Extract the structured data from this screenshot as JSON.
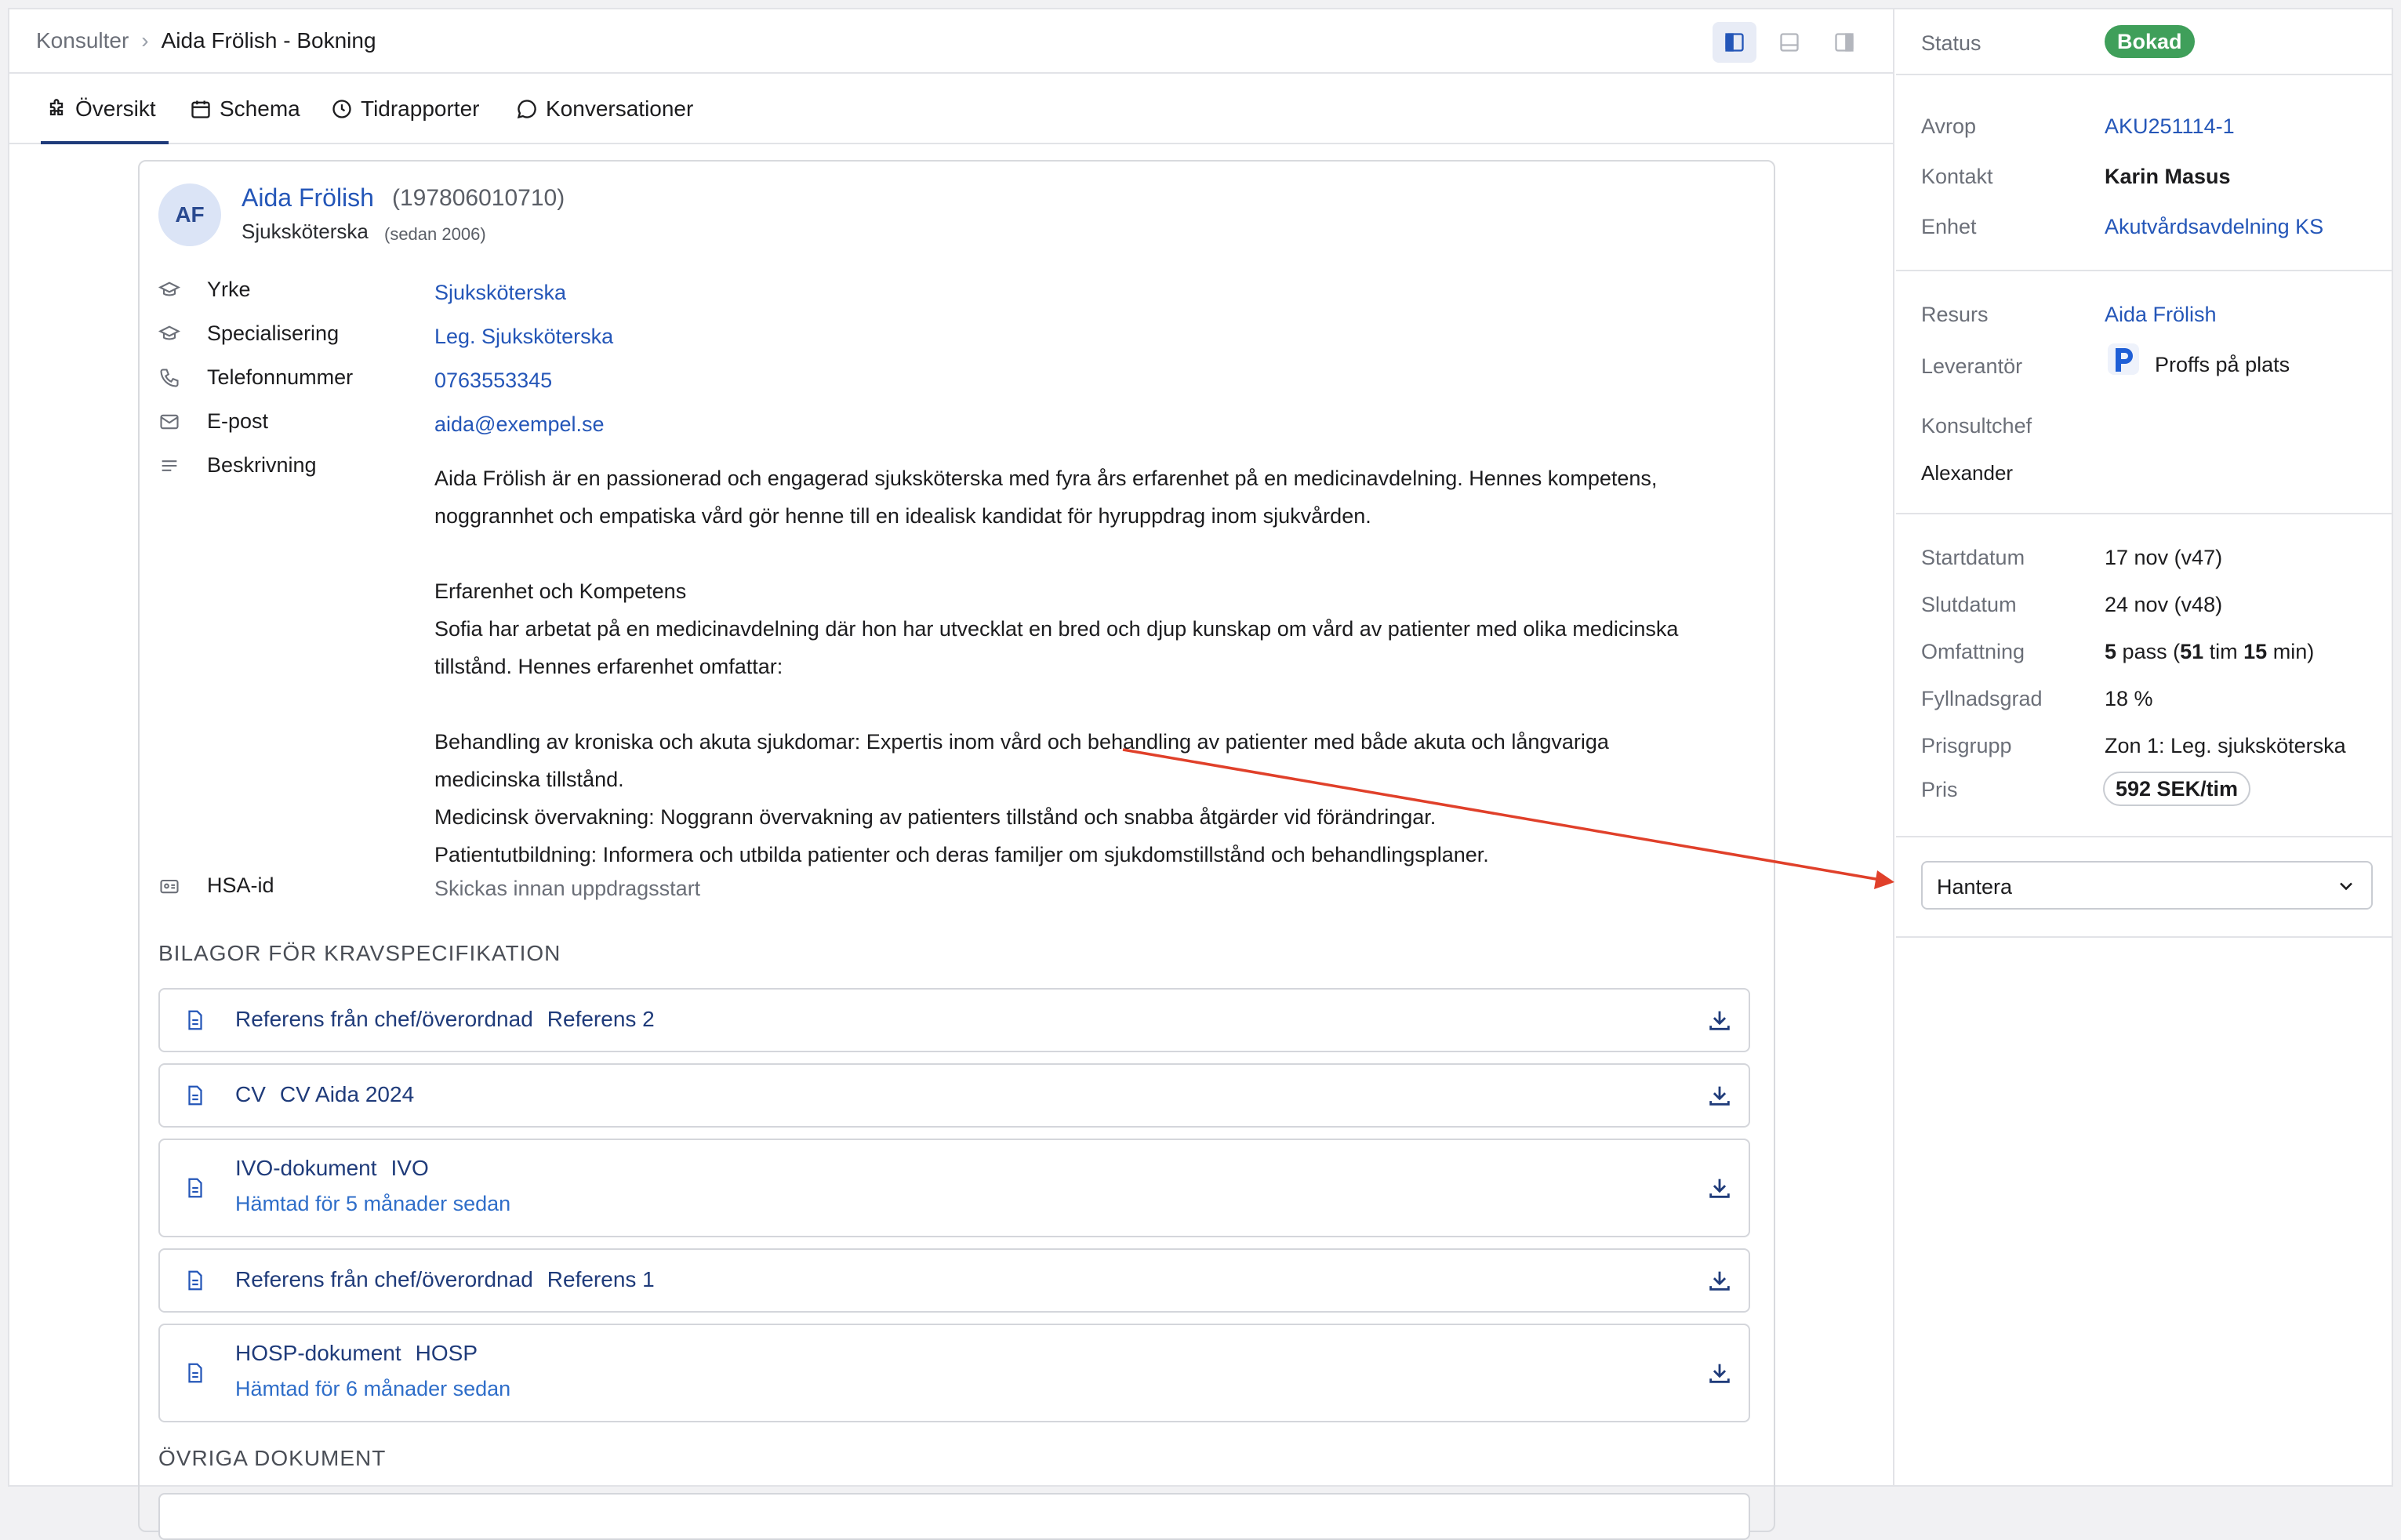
{
  "breadcrumb": {
    "root": "Konsulter",
    "current": "Aida Frölish - Bokning"
  },
  "tabs": [
    {
      "label": "Översikt",
      "icon": "puzzle-icon"
    },
    {
      "label": "Schema",
      "icon": "calendar-icon"
    },
    {
      "label": "Tidrapporter",
      "icon": "clock-icon"
    },
    {
      "label": "Konversationer",
      "icon": "chat-icon"
    }
  ],
  "profile": {
    "initials": "AF",
    "name": "Aida Frölish",
    "personal_id": "(197806010710)",
    "role": "Sjuksköterska",
    "since": "(sedan 2006)"
  },
  "details": {
    "yrke": {
      "label": "Yrke",
      "value": "Sjuksköterska"
    },
    "specialisering": {
      "label": "Specialisering",
      "value": "Leg. Sjuksköterska"
    },
    "telefon": {
      "label": "Telefonnummer",
      "value": "0763553345"
    },
    "epost": {
      "label": "E-post",
      "value": "aida@exempel.se"
    },
    "beskrivning_label": "Beskrivning",
    "beskrivning": [
      "Aida Frölish är en passionerad och engagerad sjuksköterska med fyra års erfarenhet på en medicinavdelning. Hennes kompetens,",
      "noggrannhet och empatiska vård gör henne till en idealisk kandidat för hyruppdrag inom sjukvården.",
      "",
      "Erfarenhet och Kompetens",
      "Sofia har arbetat på en medicinavdelning där hon har utvecklat en bred och djup kunskap om vård av patienter med olika medicinska",
      "tillstånd. Hennes erfarenhet omfattar:",
      "",
      "Behandling av kroniska och akuta sjukdomar: Expertis inom vård och behandling av patienter med både akuta och långvariga",
      "medicinska tillstånd.",
      "Medicinsk övervakning: Noggrann övervakning av patienters tillstånd och snabba åtgärder vid förändringar.",
      "Patientutbildning: Informera och utbilda patienter och deras familjer om sjukdomstillstånd och behandlingsplaner."
    ],
    "hsa": {
      "label": "HSA-id",
      "value": "Skickas innan uppdragsstart"
    }
  },
  "attachments_heading": "BILAGOR FÖR KRAVSPECIFIKATION",
  "attachments": [
    {
      "title": "Referens från chef/överordnad",
      "ref": "Referens 2",
      "sub": ""
    },
    {
      "title": "CV",
      "ref": "CV Aida 2024",
      "sub": ""
    },
    {
      "title": "IVO-dokument",
      "ref": "IVO",
      "sub": "Hämtad för 5 månader sedan"
    },
    {
      "title": "Referens från chef/överordnad",
      "ref": "Referens 1",
      "sub": ""
    },
    {
      "title": "HOSP-dokument",
      "ref": "HOSP",
      "sub": "Hämtad för 6 månader sedan"
    }
  ],
  "other_docs_heading": "ÖVRIGA DOKUMENT",
  "side": {
    "status_label": "Status",
    "status_value": "Bokad",
    "status_color": "#3f9f5a",
    "avrop_label": "Avrop",
    "avrop_value": "AKU251114-1",
    "kontakt_label": "Kontakt",
    "kontakt_value": "Karin Masus",
    "enhet_label": "Enhet",
    "enhet_value": "Akutvårdsavdelning KS",
    "resurs_label": "Resurs",
    "resurs_value": "Aida Frölish",
    "leverantor_label": "Leverantör",
    "leverantor_value": "Proffs på plats",
    "konsultchef_label": "Konsultchef",
    "konsultchef_value": "Alexander",
    "startdatum_label": "Startdatum",
    "startdatum_value": "17 nov (v47)",
    "slutdatum_label": "Slutdatum",
    "slutdatum_value": "24 nov (v48)",
    "omfattning_label": "Omfattning",
    "omfattning_pass": "5",
    "omfattning_pass_unit": "pass (",
    "omfattning_tim": "51",
    "omfattning_tim_unit": "tim",
    "omfattning_min": "15",
    "omfattning_min_unit": "min)",
    "fyllnadsgrad_label": "Fyllnadsgrad",
    "fyllnadsgrad_value": "18 %",
    "prisgrupp_label": "Prisgrupp",
    "prisgrupp_value": "Zon 1: Leg. sjuksköterska",
    "pris_label": "Pris",
    "pris_value": "592 SEK/tim",
    "hantera_value": "Hantera"
  },
  "colors": {
    "accent": "#1f3b7a",
    "link": "#2456b8",
    "annotation_arrow": "#e0402a"
  }
}
